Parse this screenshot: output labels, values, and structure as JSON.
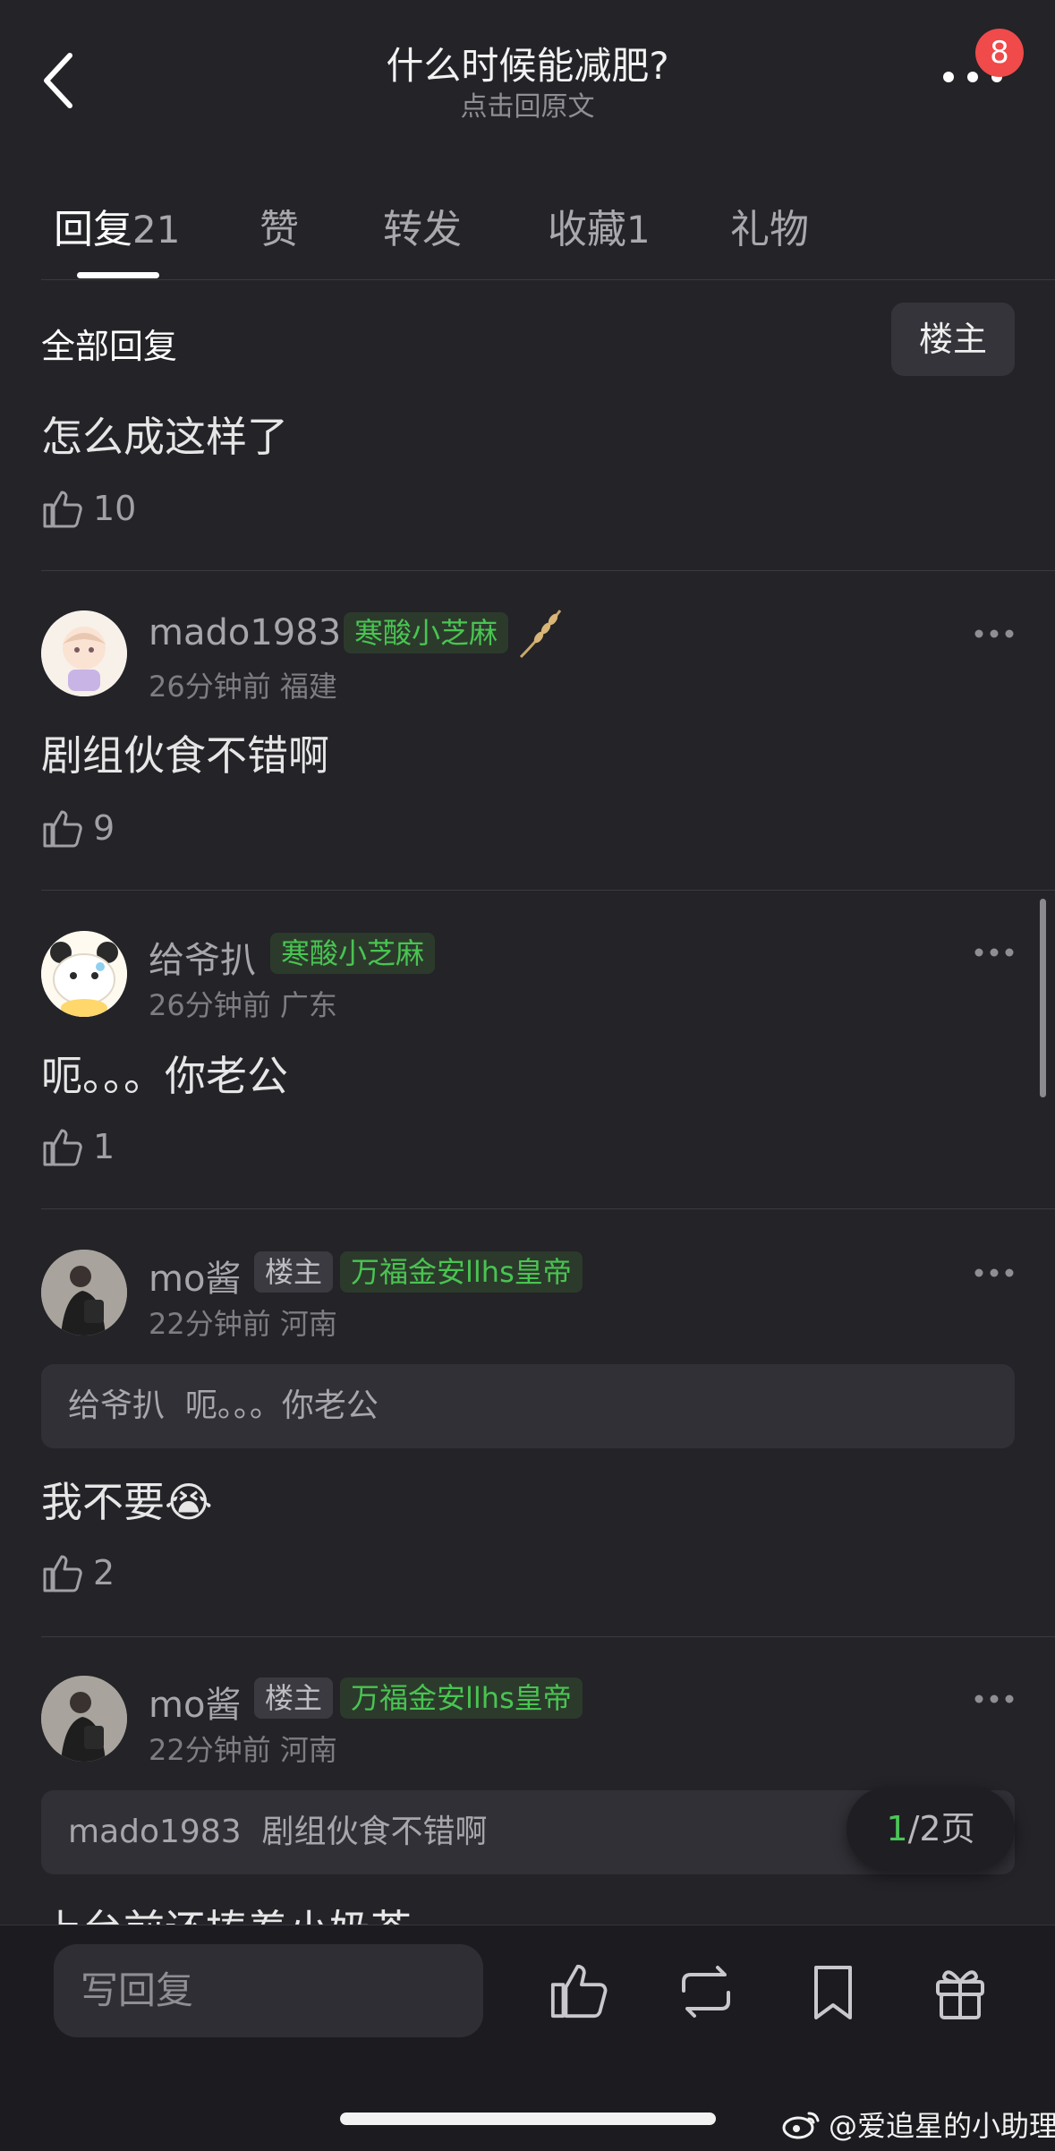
{
  "header": {
    "title": "什么时候能减肥?",
    "subtitle": "点击回原文",
    "notification_count": "8"
  },
  "tabs": [
    {
      "label": "回复",
      "count": "21",
      "active": true
    },
    {
      "label": "赞",
      "count": ""
    },
    {
      "label": "转发",
      "count": ""
    },
    {
      "label": "收藏",
      "count": "1"
    },
    {
      "label": "礼物",
      "count": ""
    }
  ],
  "filter": {
    "all_replies": "全部回复",
    "op_only": "楼主"
  },
  "first_comment": {
    "text": "怎么成这样了",
    "likes": "10"
  },
  "comments": [
    {
      "username": "mado1983",
      "badge": "寒酸小芝麻",
      "meta": "26分钟前 福建",
      "text": "剧组伙食不错啊",
      "likes": "9"
    },
    {
      "username": "给爷扒",
      "badge": "寒酸小芝麻",
      "meta": "26分钟前 广东",
      "text": "呃。。。你老公",
      "likes": "1"
    },
    {
      "username": "mo酱",
      "op_tag": "楼主",
      "badge": "万福金安llhs皇帝",
      "meta": "22分钟前 河南",
      "quote_user": "给爷扒",
      "quote_text": "呃。。。你老公",
      "text": "我不要",
      "emoji": "😭",
      "likes": "2"
    },
    {
      "username": "mo酱",
      "op_tag": "楼主",
      "badge": "万福金安llhs皇帝",
      "meta": "22分钟前 河南",
      "quote_user": "mado1983",
      "quote_text": "剧组伙食不错啊",
      "text": "上台前还捧着小奶茶"
    }
  ],
  "pager": {
    "current": "1",
    "rest": "/2页"
  },
  "bottom_bar": {
    "write_placeholder": "写回复",
    "icons": [
      "like-icon",
      "repost-icon",
      "bookmark-icon",
      "gift-icon"
    ]
  },
  "watermark": "@爱追星的小助理",
  "colors": {
    "background": "#232328",
    "badge_green": "#49c451",
    "notification_red": "#f04a4a"
  }
}
